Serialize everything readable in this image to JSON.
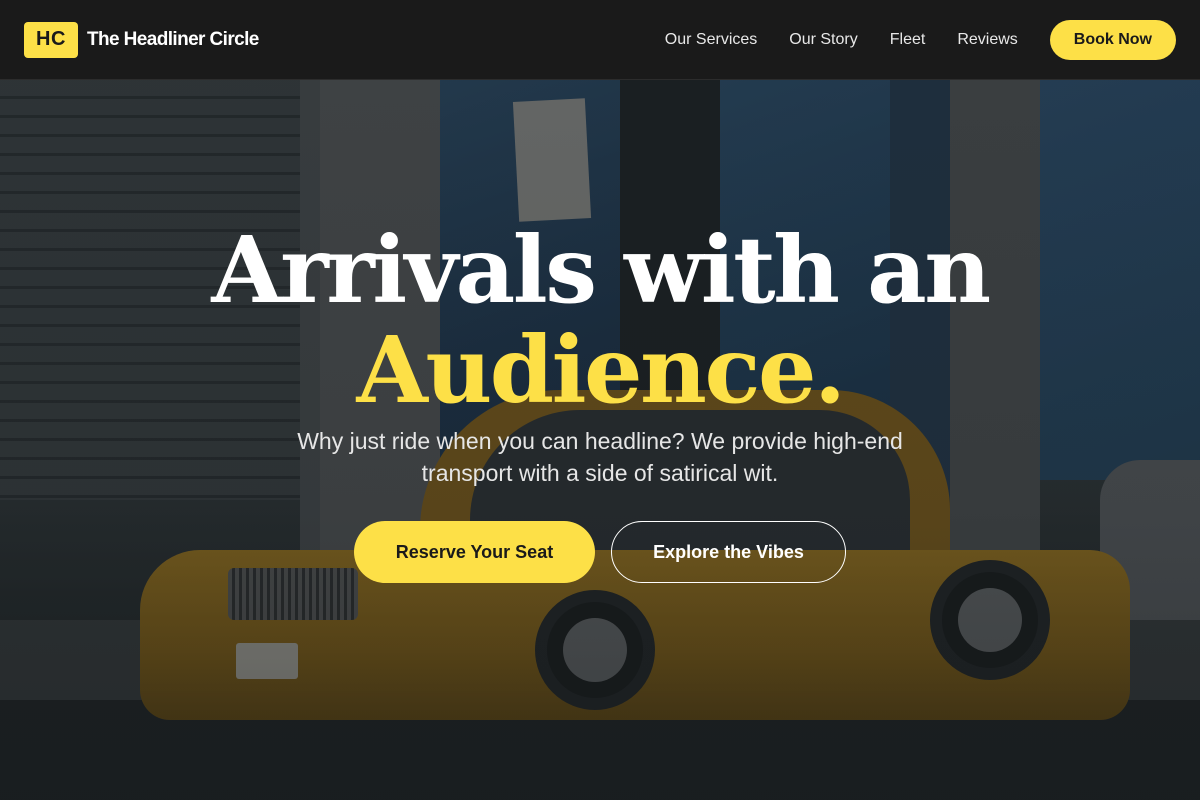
{
  "brand": {
    "logo_text": "HC",
    "name": "The Headliner Circle"
  },
  "nav": {
    "links": [
      "Our Services",
      "Our Story",
      "Fleet",
      "Reviews"
    ],
    "book_label": "Book Now"
  },
  "hero": {
    "headline_line1": "Arrivals with an",
    "headline_line2": "Audience.",
    "subtitle": "Why just ride when you can headline? We provide high-end transport with a side of satirical wit.",
    "primary_cta": "Reserve Your Seat",
    "secondary_cta": "Explore the Vibes",
    "background_image": "yellow taxi cab parked on city street"
  },
  "colors": {
    "accent": "#fde047",
    "navbar_bg": "#1a1a1a",
    "text_light": "#ffffff"
  }
}
